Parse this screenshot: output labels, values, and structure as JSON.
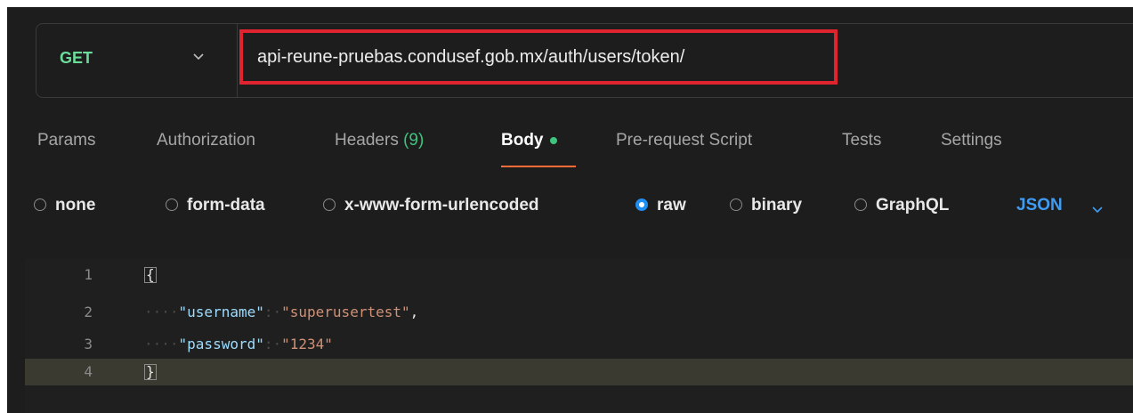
{
  "request": {
    "method": "GET",
    "url": "api-reune-pruebas.condusef.gob.mx/auth/users/token/"
  },
  "tabs": {
    "params": "Params",
    "authorization": "Authorization",
    "headers_label": "Headers",
    "headers_count": "(9)",
    "body": "Body",
    "prerequest": "Pre-request Script",
    "tests": "Tests",
    "settings": "Settings"
  },
  "body_options": {
    "none": "none",
    "form_data": "form-data",
    "urlencoded": "x-www-form-urlencoded",
    "raw": "raw",
    "binary": "binary",
    "graphql": "GraphQL",
    "format": "JSON",
    "selected": "raw"
  },
  "editor": {
    "lines": [
      {
        "number": "1",
        "open": "{"
      },
      {
        "number": "2",
        "indent": "····",
        "key": "\"username\"",
        "sep": ":·",
        "value": "\"superusertest\"",
        "trail": ","
      },
      {
        "number": "3",
        "indent": "····",
        "key": "\"password\"",
        "sep": ":·",
        "value": "\"1234\""
      },
      {
        "number": "4",
        "close": "}"
      }
    ]
  },
  "colors": {
    "method_get": "#6bdd9a",
    "highlight_box": "#e0242f",
    "active_tab_underline": "#ff6c37",
    "json_link": "#3f9cf2",
    "radio_selected": "#1f8ef1"
  }
}
